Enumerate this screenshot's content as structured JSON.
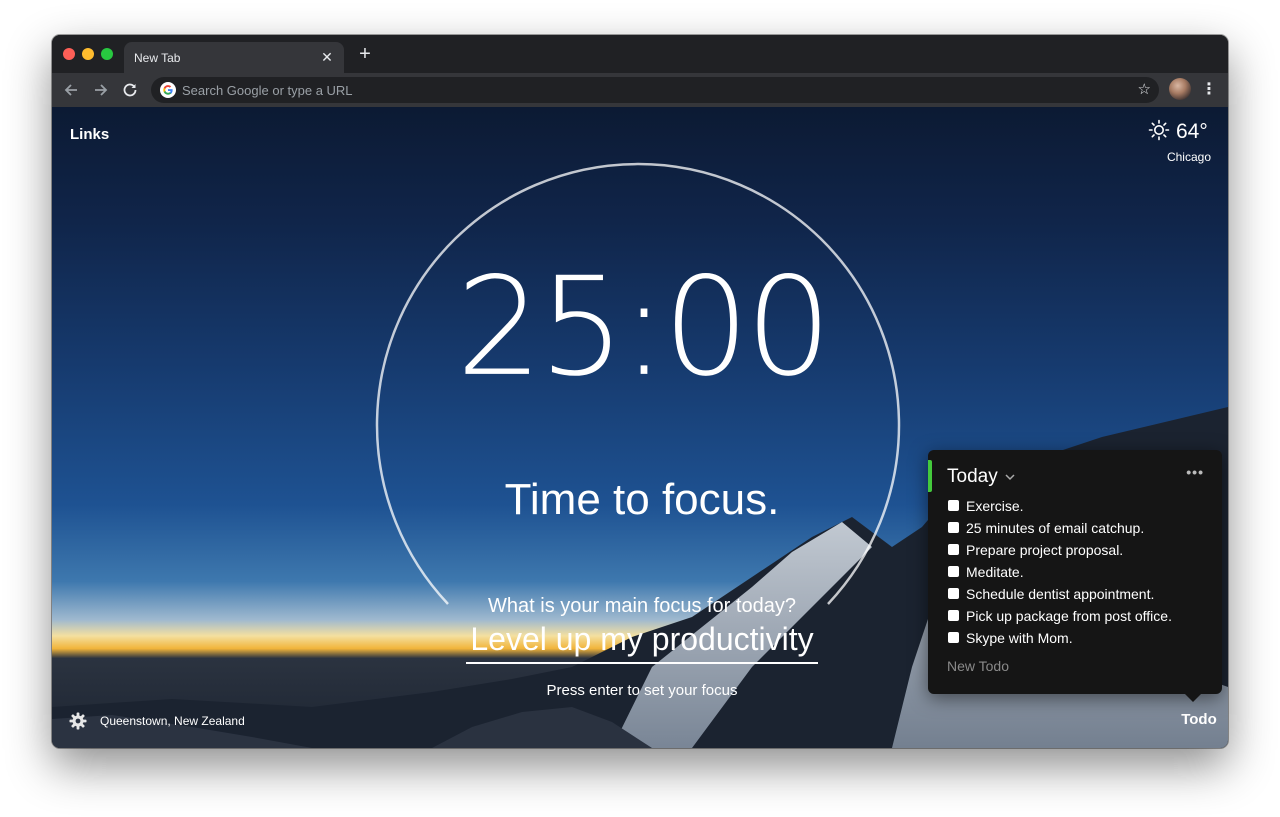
{
  "browser": {
    "tab_title": "New Tab",
    "tab_close": "✕",
    "new_tab": "+",
    "omnibox_placeholder": "Search Google or type a URL",
    "icons": [
      "back-arrow-icon",
      "forward-arrow-icon",
      "reload-icon",
      "google-icon",
      "star-icon",
      "profile-avatar",
      "menu-icon"
    ]
  },
  "header": {
    "links_label": "Links",
    "temperature": "64°",
    "city": "Chicago",
    "weather_icon": "sun-icon"
  },
  "timer": {
    "time": "25:00",
    "label": "Time to focus."
  },
  "focus": {
    "prompt": "What is your main focus for today?",
    "value": "Level up my productivity",
    "hint": "Press enter to set your focus"
  },
  "footer": {
    "location": "Queenstown, New Zealand",
    "todo_label": "Todo"
  },
  "todo": {
    "list_title": "Today",
    "more": "•••",
    "accent_color": "#44c93c",
    "items": [
      {
        "text": "Exercise."
      },
      {
        "text": "25 minutes of email catchup."
      },
      {
        "text": "Prepare project proposal."
      },
      {
        "text": "Meditate."
      },
      {
        "text": "Schedule dentist appointment."
      },
      {
        "text": "Pick up package from post office."
      },
      {
        "text": "Skype with Mom."
      }
    ],
    "new_placeholder": "New Todo"
  }
}
